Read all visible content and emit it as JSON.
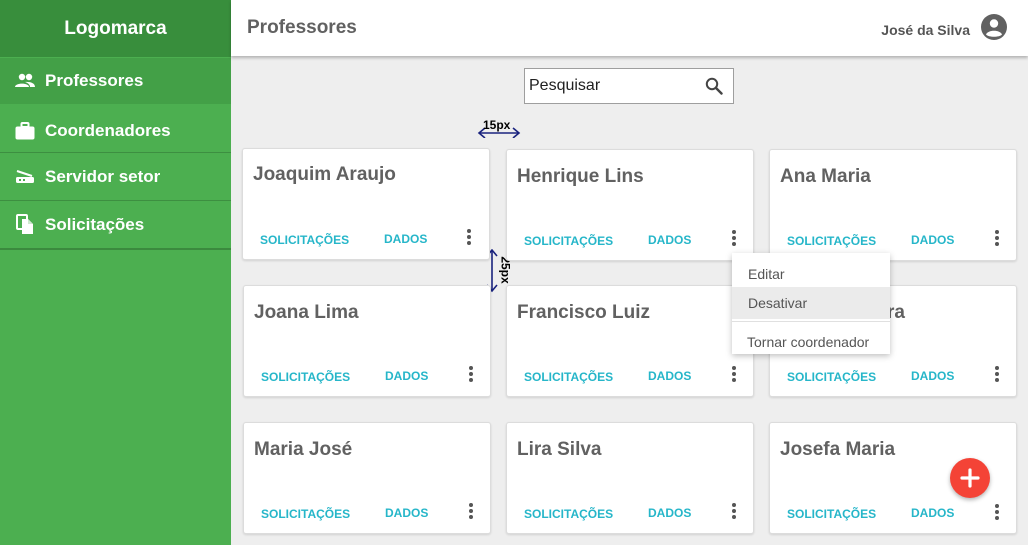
{
  "sidebar": {
    "logo": "Logomarca",
    "items": [
      {
        "label": "Professores",
        "icon": "people-icon"
      },
      {
        "label": "Coordenadores",
        "icon": "briefcase-icon"
      },
      {
        "label": "Servidor setor",
        "icon": "router-icon"
      },
      {
        "label": "Solicitações",
        "icon": "copy-icon"
      }
    ]
  },
  "header": {
    "title": "Professores",
    "user_name": "José da Silva",
    "avatar_icon": "account-circle-icon"
  },
  "search": {
    "placeholder": "Pesquisar",
    "icon": "search-icon"
  },
  "card_actions": {
    "requests": "SOLICITAÇÕES",
    "data": "DADOS"
  },
  "cards": [
    {
      "name": "Joaquim Araujo"
    },
    {
      "name": "Henrique Lins"
    },
    {
      "name": "Ana Maria"
    },
    {
      "name": "Joana Lima"
    },
    {
      "name": "Francisco Luiz"
    },
    {
      "name": "ra"
    },
    {
      "name": "Maria José"
    },
    {
      "name": "Lira Silva"
    },
    {
      "name": "Josefa Maria"
    }
  ],
  "dropdown": {
    "items": [
      "Editar",
      "Desativar",
      "Tornar coordenador"
    ]
  },
  "annotations": {
    "horizontal_gap": "15px",
    "vertical_gap": "25px"
  },
  "colors": {
    "sidebar": "#4caf50",
    "logo_bar": "#388e3c",
    "action_text": "#26b6c9",
    "fab": "#f44336"
  }
}
